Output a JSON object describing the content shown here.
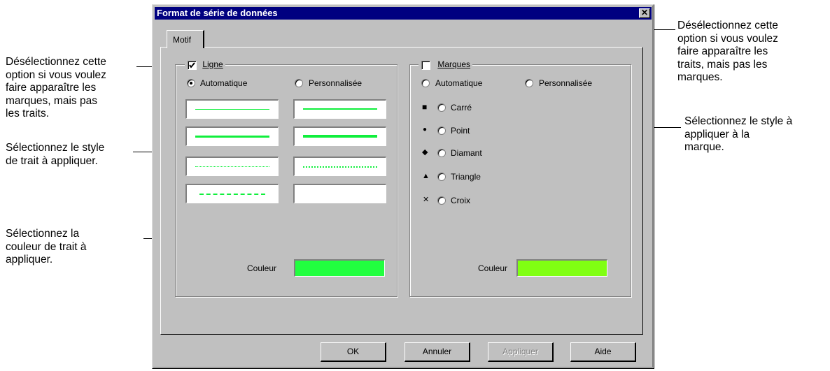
{
  "dialog": {
    "title": "Format de série de données",
    "close_glyph": "✕",
    "tab_label": "Motif"
  },
  "ligne": {
    "group_label": "Ligne",
    "checked": true,
    "auto_label": "Automatique",
    "custom_label": "Personnalisée",
    "selected": "auto",
    "couleur_label": "Couleur",
    "color": "#21ff3f",
    "line_color": "#10ef3c"
  },
  "marques": {
    "group_label": "Marques",
    "checked": false,
    "auto_label": "Automatique",
    "custom_label": "Personnalisée",
    "shapes": [
      {
        "label": "Carré",
        "marker": "■"
      },
      {
        "label": "Point",
        "marker": "●"
      },
      {
        "label": "Diamant",
        "marker": "◆"
      },
      {
        "label": "Triangle",
        "marker": "▲"
      },
      {
        "label": "Croix",
        "marker": "✕"
      }
    ],
    "couleur_label": "Couleur",
    "color": "#80ff12"
  },
  "buttons": {
    "ok": "OK",
    "annuler": "Annuler",
    "appliquer": "Appliquer",
    "aide": "Aide"
  },
  "callouts": {
    "left_1": "Désélectionnez cette\noption si vous voulez\nfaire apparaître les\nmarques, mais pas\nles traits.",
    "left_2": "Sélectionnez le style\nde trait à appliquer.",
    "left_3": "Sélectionnez la\ncouleur de trait à\nappliquer.",
    "right_1": "Désélectionnez cette\noption si vous voulez\nfaire apparaître les\ntraits, mais pas les\nmarques.",
    "right_2": "Sélectionnez le style à\nappliquer à la\nmarque."
  }
}
